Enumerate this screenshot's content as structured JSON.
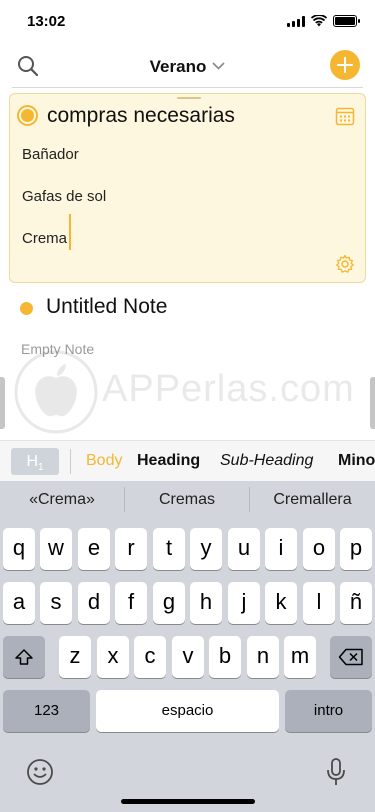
{
  "status_bar": {
    "time": "13:02"
  },
  "nav": {
    "title": "Verano"
  },
  "notes": [
    {
      "title": "compras necesarias",
      "lines": [
        "Bañador",
        "Gafas de sol",
        "Crema"
      ]
    },
    {
      "title": "Untitled Note",
      "subtitle": "Empty Note"
    }
  ],
  "watermark": {
    "text": "APPerlas.com"
  },
  "format_bar": {
    "h1": "H",
    "h1_sub": "1",
    "styles": [
      "Body",
      "Heading",
      "Sub-Heading",
      "Mino"
    ]
  },
  "keyboard": {
    "suggestions": [
      "«Crema»",
      "Cremas",
      "Cremallera"
    ],
    "row1": [
      "q",
      "w",
      "e",
      "r",
      "t",
      "y",
      "u",
      "i",
      "o",
      "p"
    ],
    "row2": [
      "a",
      "s",
      "d",
      "f",
      "g",
      "h",
      "j",
      "k",
      "l",
      "ñ"
    ],
    "row3": [
      "z",
      "x",
      "c",
      "v",
      "b",
      "n",
      "m"
    ],
    "numbers_key": "123",
    "space_key": "espacio",
    "return_key": "intro"
  },
  "colors": {
    "accent": "#f5b731",
    "card_bg": "#fdf7df",
    "keyboard_bg": "#d2d5db"
  },
  "icons": [
    "search-icon",
    "chevron-down-icon",
    "add-icon",
    "calendar-icon",
    "gear-icon",
    "shift-icon",
    "delete-icon",
    "emoji-icon",
    "microphone-icon"
  ]
}
